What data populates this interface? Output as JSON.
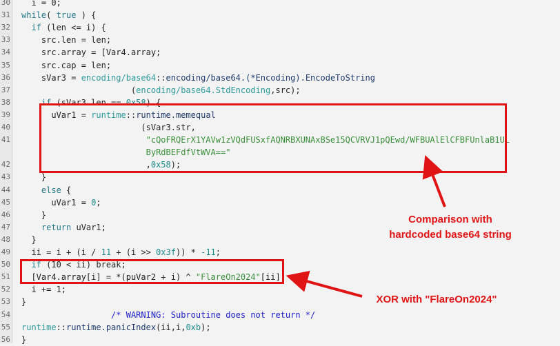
{
  "code_lines": [
    {
      "n": "30",
      "segs": [
        {
          "t": "  i = 0;",
          "c": "pl"
        }
      ]
    },
    {
      "n": "31",
      "segs": [
        {
          "t": "while",
          "c": "kw"
        },
        {
          "t": "( ",
          "c": "pl"
        },
        {
          "t": "true",
          "c": "kw"
        },
        {
          "t": " ) {",
          "c": "pl"
        }
      ]
    },
    {
      "n": "32",
      "segs": [
        {
          "t": "  if",
          "c": "kw"
        },
        {
          "t": " (len <= i) {",
          "c": "pl"
        }
      ]
    },
    {
      "n": "33",
      "segs": [
        {
          "t": "    src.len = len;",
          "c": "pl"
        }
      ]
    },
    {
      "n": "34",
      "segs": [
        {
          "t": "    src.array = [Var4.array;",
          "c": "pl"
        }
      ]
    },
    {
      "n": "35",
      "segs": [
        {
          "t": "    src.cap = len;",
          "c": "pl"
        }
      ]
    },
    {
      "n": "36",
      "segs": [
        {
          "t": "    sVar3 = ",
          "c": "pl"
        },
        {
          "t": "encoding/base64",
          "c": "lib"
        },
        {
          "t": "::",
          "c": "pl"
        },
        {
          "t": "encoding/base64.(*Encoding).EncodeToString",
          "c": "fn"
        }
      ]
    },
    {
      "n": "37",
      "segs": [
        {
          "t": "                      (",
          "c": "pl"
        },
        {
          "t": "encoding/base64.StdEncoding",
          "c": "lib"
        },
        {
          "t": ",src);",
          "c": "pl"
        }
      ]
    },
    {
      "n": "38",
      "segs": [
        {
          "t": "    if",
          "c": "kw"
        },
        {
          "t": " (sVar3.len == ",
          "c": "pl"
        },
        {
          "t": "0x58",
          "c": "num"
        },
        {
          "t": ") {",
          "c": "pl"
        }
      ]
    },
    {
      "n": "39",
      "segs": [
        {
          "t": "      uVar1 = ",
          "c": "pl"
        },
        {
          "t": "runtime",
          "c": "lib"
        },
        {
          "t": "::",
          "c": "pl"
        },
        {
          "t": "runtime.memequal",
          "c": "fn"
        }
      ]
    },
    {
      "n": "40",
      "segs": [
        {
          "t": "                        (sVar3.str,",
          "c": "pl"
        }
      ]
    },
    {
      "n": "41",
      "segs": [
        {
          "t": "                         \"cQoFRQErX1YAVw1zVQdFUSxfAQNRBXUNAxBSe15QCVRVJ1pQEwd/WFBUAlElCFBFUnlaB1UL",
          "c": "str"
        }
      ]
    },
    {
      "n": "",
      "segs": [
        {
          "t": "                         ByRdBEFdfVtWVA==\"",
          "c": "str"
        }
      ]
    },
    {
      "n": "42",
      "segs": [
        {
          "t": "                         ,",
          "c": "pl"
        },
        {
          "t": "0x58",
          "c": "num"
        },
        {
          "t": ");",
          "c": "pl"
        }
      ]
    },
    {
      "n": "43",
      "segs": [
        {
          "t": "    }",
          "c": "pl"
        }
      ]
    },
    {
      "n": "44",
      "segs": [
        {
          "t": "    else",
          "c": "kw"
        },
        {
          "t": " {",
          "c": "pl"
        }
      ]
    },
    {
      "n": "45",
      "segs": [
        {
          "t": "      uVar1 = ",
          "c": "pl"
        },
        {
          "t": "0",
          "c": "num"
        },
        {
          "t": ";",
          "c": "pl"
        }
      ]
    },
    {
      "n": "46",
      "segs": [
        {
          "t": "    }",
          "c": "pl"
        }
      ]
    },
    {
      "n": "47",
      "segs": [
        {
          "t": "    return",
          "c": "kw"
        },
        {
          "t": " uVar1;",
          "c": "pl"
        }
      ]
    },
    {
      "n": "48",
      "segs": [
        {
          "t": "  }",
          "c": "pl"
        }
      ]
    },
    {
      "n": "49",
      "segs": [
        {
          "t": "  ii = i + (i / ",
          "c": "pl"
        },
        {
          "t": "11",
          "c": "num"
        },
        {
          "t": " + (i >> ",
          "c": "pl"
        },
        {
          "t": "0x3f",
          "c": "num"
        },
        {
          "t": ")) * ",
          "c": "pl"
        },
        {
          "t": "-11",
          "c": "num"
        },
        {
          "t": ";",
          "c": "pl"
        }
      ]
    },
    {
      "n": "50",
      "segs": [
        {
          "t": "  if",
          "c": "kw"
        },
        {
          "t": " (10 < ii) break;",
          "c": "pl"
        }
      ]
    },
    {
      "n": "51",
      "segs": [
        {
          "t": "  [Var4.array[i] = *(puVar2 + i) ^ ",
          "c": "pl"
        },
        {
          "t": "\"FlareOn2024\"",
          "c": "str"
        },
        {
          "t": "[ii];",
          "c": "pl"
        }
      ]
    },
    {
      "n": "52",
      "segs": [
        {
          "t": "  i += 1;",
          "c": "pl"
        }
      ]
    },
    {
      "n": "53",
      "segs": [
        {
          "t": "}",
          "c": "pl"
        }
      ]
    },
    {
      "n": "54",
      "segs": [
        {
          "t": "                  ",
          "c": "pl"
        },
        {
          "t": "/* WARNING: Subroutine does not return */",
          "c": "cm"
        }
      ]
    },
    {
      "n": "55",
      "segs": [
        {
          "t": "runtime",
          "c": "lib"
        },
        {
          "t": "::",
          "c": "pl"
        },
        {
          "t": "runtime.panicIndex",
          "c": "fn"
        },
        {
          "t": "(ii,i,",
          "c": "pl"
        },
        {
          "t": "0xb",
          "c": "num"
        },
        {
          "t": ");",
          "c": "pl"
        }
      ]
    },
    {
      "n": "56",
      "segs": [
        {
          "t": "}",
          "c": "pl"
        }
      ]
    }
  ],
  "annotations": {
    "comparison_note": "Comparison with\nhardcoded base64 string",
    "xor_note": "XOR with \"FlareOn2024\""
  },
  "colors": {
    "annotation_red": "#e01414",
    "background": "#f3f3f3"
  }
}
